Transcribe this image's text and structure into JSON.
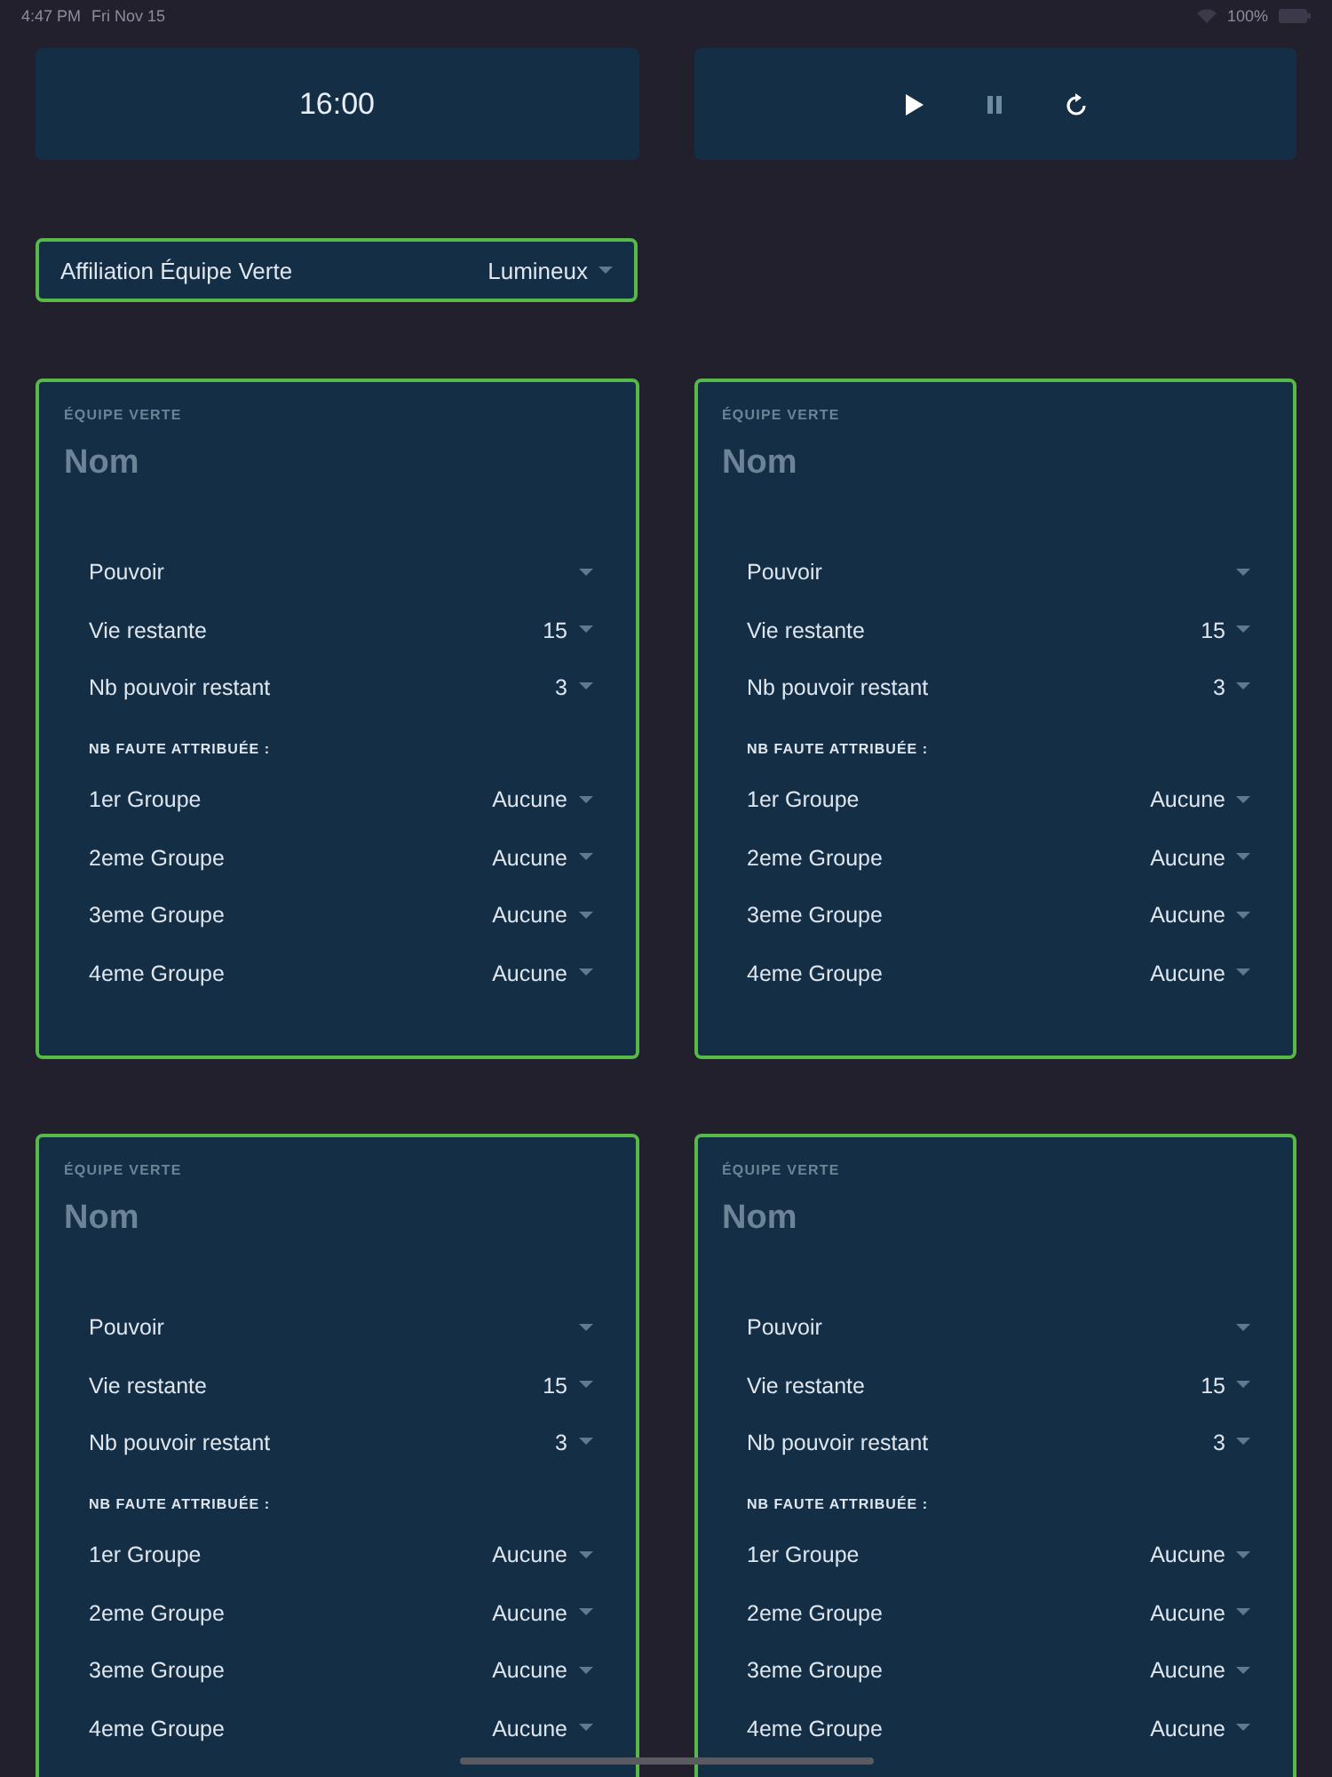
{
  "status_bar": {
    "time": "4:47 PM",
    "date": "Fri Nov 15",
    "battery": "100%"
  },
  "timer": {
    "time": "16:00"
  },
  "controls": [
    {
      "kind": "play",
      "disabled": false
    },
    {
      "kind": "pause",
      "disabled": true
    },
    {
      "kind": "reset",
      "disabled": false
    }
  ],
  "affiliation": {
    "label": "Affiliation Équipe Verte",
    "value": "Lumineux"
  },
  "teams": [
    {
      "header": "ÉQUIPE VERTE",
      "name_placeholder": "Nom",
      "fields": [
        {
          "label": "Pouvoir"
        },
        {
          "label": "Vie restante",
          "value": "15"
        },
        {
          "label": "Nb pouvoir restant",
          "value": "3"
        }
      ],
      "faults_heading": "NB FAUTE ATTRIBUÉE :",
      "faults": [
        {
          "label": "1er Groupe",
          "value": "Aucune"
        },
        {
          "label": "2eme Groupe",
          "value": "Aucune"
        },
        {
          "label": "3eme Groupe",
          "value": "Aucune"
        },
        {
          "label": "4eme Groupe",
          "value": "Aucune"
        }
      ]
    },
    {
      "header": "ÉQUIPE VERTE",
      "name_placeholder": "Nom",
      "fields": [
        {
          "label": "Pouvoir"
        },
        {
          "label": "Vie restante",
          "value": "15"
        },
        {
          "label": "Nb pouvoir restant",
          "value": "3"
        }
      ],
      "faults_heading": "NB FAUTE ATTRIBUÉE :",
      "faults": [
        {
          "label": "1er Groupe",
          "value": "Aucune"
        },
        {
          "label": "2eme Groupe",
          "value": "Aucune"
        },
        {
          "label": "3eme Groupe",
          "value": "Aucune"
        },
        {
          "label": "4eme Groupe",
          "value": "Aucune"
        }
      ]
    },
    {
      "header": "ÉQUIPE VERTE",
      "name_placeholder": "Nom",
      "fields": [
        {
          "label": "Pouvoir"
        },
        {
          "label": "Vie restante",
          "value": "15"
        },
        {
          "label": "Nb pouvoir restant",
          "value": "3"
        }
      ],
      "faults_heading": "NB FAUTE ATTRIBUÉE :",
      "faults": [
        {
          "label": "1er Groupe",
          "value": "Aucune"
        },
        {
          "label": "2eme Groupe",
          "value": "Aucune"
        },
        {
          "label": "3eme Groupe",
          "value": "Aucune"
        },
        {
          "label": "4eme Groupe",
          "value": "Aucune"
        }
      ]
    },
    {
      "header": "ÉQUIPE VERTE",
      "name_placeholder": "Nom",
      "fields": [
        {
          "label": "Pouvoir"
        },
        {
          "label": "Vie restante",
          "value": "15"
        },
        {
          "label": "Nb pouvoir restant",
          "value": "3"
        }
      ],
      "faults_heading": "NB FAUTE ATTRIBUÉE :",
      "faults": [
        {
          "label": "1er Groupe",
          "value": "Aucune"
        },
        {
          "label": "2eme Groupe",
          "value": "Aucune"
        },
        {
          "label": "3eme Groupe",
          "value": "Aucune"
        },
        {
          "label": "4eme Groupe",
          "value": "Aucune"
        }
      ]
    }
  ]
}
